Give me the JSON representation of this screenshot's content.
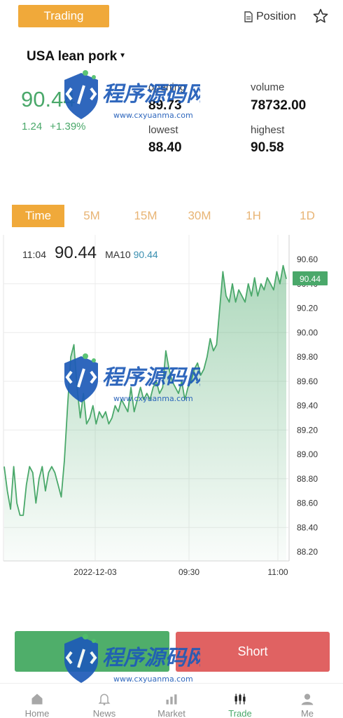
{
  "header": {
    "trading_label": "Trading",
    "position_label": "Position"
  },
  "instrument": {
    "name": "USA lean pork",
    "price": "90.44",
    "change": "1.24",
    "change_pct": "+1.39%"
  },
  "stats": {
    "opening_label": "opening",
    "opening_value": "89.73",
    "volume_label": "volume",
    "volume_value": "78732.00",
    "lowest_label": "lowest",
    "lowest_value": "88.40",
    "highest_label": "highest",
    "highest_value": "90.58"
  },
  "period_tabs": [
    "Time",
    "5M",
    "15M",
    "30M",
    "1H",
    "1D"
  ],
  "active_period": "Time",
  "chart_info": {
    "time": "11:04",
    "value": "90.44",
    "ma_label": "MA10",
    "ma_value": "90.44"
  },
  "chart_data": {
    "type": "area",
    "y_ticks": [
      "90.60",
      "90.40",
      "90.20",
      "90.00",
      "89.80",
      "89.60",
      "89.40",
      "89.20",
      "89.00",
      "88.80",
      "88.60",
      "88.40",
      "88.20"
    ],
    "x_ticks": [
      "2022-12-03",
      "09:30",
      "11:00"
    ],
    "ylim": [
      88.15,
      90.7
    ],
    "current_price_tag": "90.44",
    "values": [
      88.9,
      88.7,
      88.55,
      88.9,
      88.6,
      88.5,
      88.5,
      88.75,
      88.9,
      88.85,
      88.6,
      88.8,
      88.9,
      88.7,
      88.85,
      88.9,
      88.85,
      88.75,
      88.65,
      88.95,
      89.4,
      89.8,
      89.9,
      89.55,
      89.3,
      89.5,
      89.25,
      89.3,
      89.4,
      89.25,
      89.35,
      89.3,
      89.35,
      89.25,
      89.3,
      89.4,
      89.35,
      89.45,
      89.4,
      89.35,
      89.55,
      89.35,
      89.45,
      89.55,
      89.45,
      89.5,
      89.45,
      89.55,
      89.6,
      89.5,
      89.55,
      89.85,
      89.7,
      89.6,
      89.55,
      89.5,
      89.6,
      89.45,
      89.55,
      89.6,
      89.7,
      89.75,
      89.65,
      89.7,
      89.8,
      89.95,
      89.85,
      89.9,
      90.2,
      90.5,
      90.3,
      90.25,
      90.4,
      90.25,
      90.35,
      90.3,
      90.25,
      90.4,
      90.3,
      90.45,
      90.3,
      90.4,
      90.35,
      90.45,
      90.4,
      90.35,
      90.5,
      90.4,
      90.55,
      90.44
    ]
  },
  "actions": {
    "long_label": "",
    "short_label": "Short"
  },
  "bottom_nav": [
    {
      "label": "Home",
      "icon": "home-icon"
    },
    {
      "label": "News",
      "icon": "bell-icon"
    },
    {
      "label": "Market",
      "icon": "bar-chart-icon"
    },
    {
      "label": "Trade",
      "icon": "candlestick-icon"
    },
    {
      "label": "Me",
      "icon": "user-icon"
    }
  ],
  "watermark": {
    "text_cn": "程序源码网",
    "text_url": "www.cxyuanma.com"
  },
  "colors": {
    "accent": "#f0a93a",
    "up_green": "#4aa86a",
    "short_red": "#e06262",
    "long_green": "#4fae6a"
  }
}
